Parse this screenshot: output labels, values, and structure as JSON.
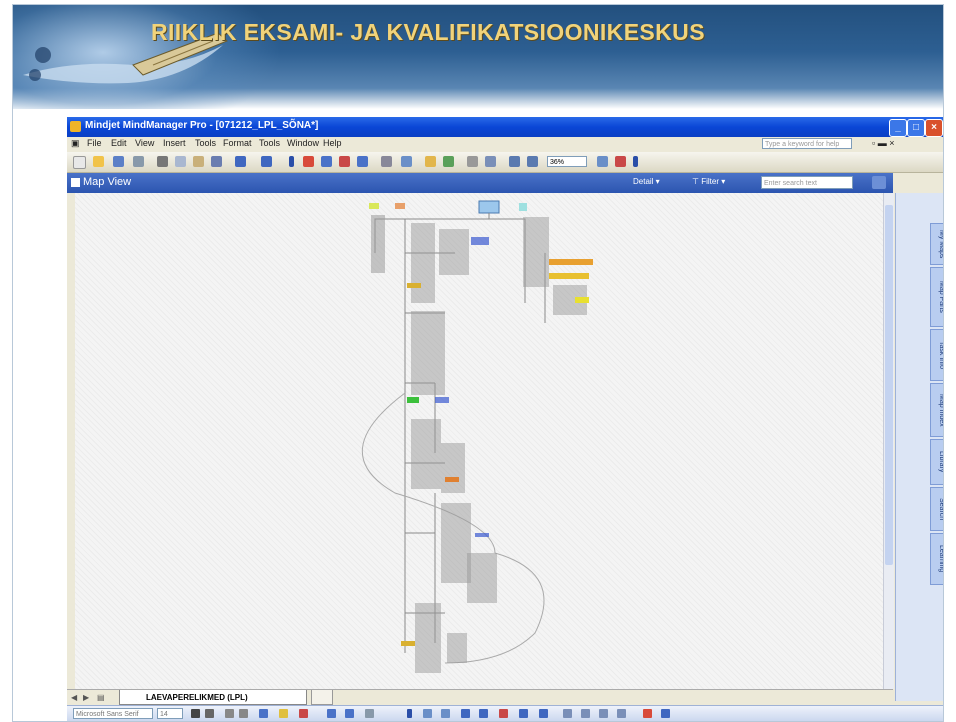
{
  "banner": {
    "title": "RIIKLIK EKSAMI- JA KVALIFIKATSIOONIKESKUS"
  },
  "app": {
    "window_title": "Mindjet MindManager Pro - [071212_LPL_SÕNA*]",
    "menu": [
      "File",
      "Edit",
      "View",
      "Insert",
      "Tools",
      "Format",
      "Tools",
      "Window",
      "Help"
    ],
    "help_placeholder": "Type a keyword for help",
    "zoom": "36%"
  },
  "map_view": {
    "title": "Map View",
    "detail_label": "Detail",
    "filter_label": "Filter",
    "search_placeholder": "Enter search text",
    "central_topic_color": "#9cc7ec"
  },
  "side_tabs": [
    "My Maps",
    "Map Parts",
    "Task Info",
    "Map Index",
    "Library",
    "Search",
    "Learning"
  ],
  "sheet": {
    "name": "LAEVAPERELIKMED (LPL)"
  },
  "format_bar": {
    "font": "Microsoft Sans Serif",
    "size": "14"
  }
}
